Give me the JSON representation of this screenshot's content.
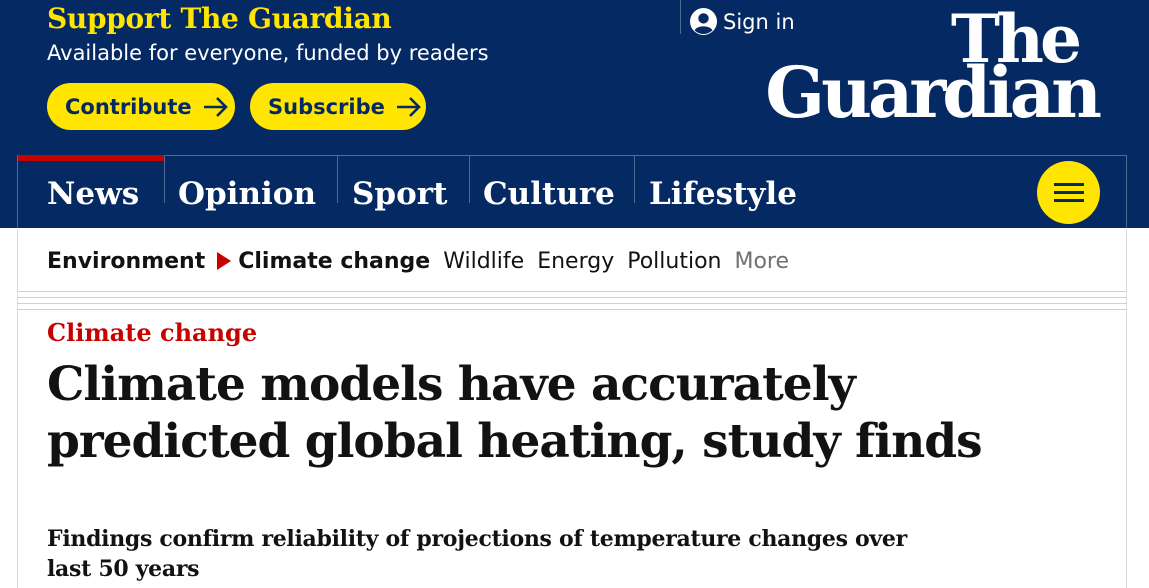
{
  "support": {
    "title": "Support The Guardian",
    "subtitle": "Available for everyone, funded by readers",
    "contribute_label": "Contribute",
    "subscribe_label": "Subscribe"
  },
  "account": {
    "sign_in_label": "Sign in"
  },
  "logo": {
    "line1": "The",
    "line2": "Guardian"
  },
  "pillars": [
    {
      "label": "News",
      "active": true
    },
    {
      "label": "Opinion",
      "active": false
    },
    {
      "label": "Sport",
      "active": false
    },
    {
      "label": "Culture",
      "active": false
    },
    {
      "label": "Lifestyle",
      "active": false
    }
  ],
  "subnav": {
    "section": "Environment",
    "current": "Climate change",
    "items": [
      "Wildlife",
      "Energy",
      "Pollution"
    ],
    "more_label": "More"
  },
  "article": {
    "kicker": "Climate change",
    "headline": "Climate models have accurately predicted global heating, study finds",
    "standfirst": "Findings confirm reliability of projections of temperature changes over last 50 years"
  },
  "colors": {
    "brand_blue": "#052962",
    "support_yellow": "#ffe500",
    "news_red": "#c70000"
  },
  "icons": {
    "account": "user-circle-icon",
    "cta_arrow": "arrow-right-icon",
    "menu": "hamburger-menu-icon",
    "breadcrumb_marker": "triangle-right-icon"
  }
}
